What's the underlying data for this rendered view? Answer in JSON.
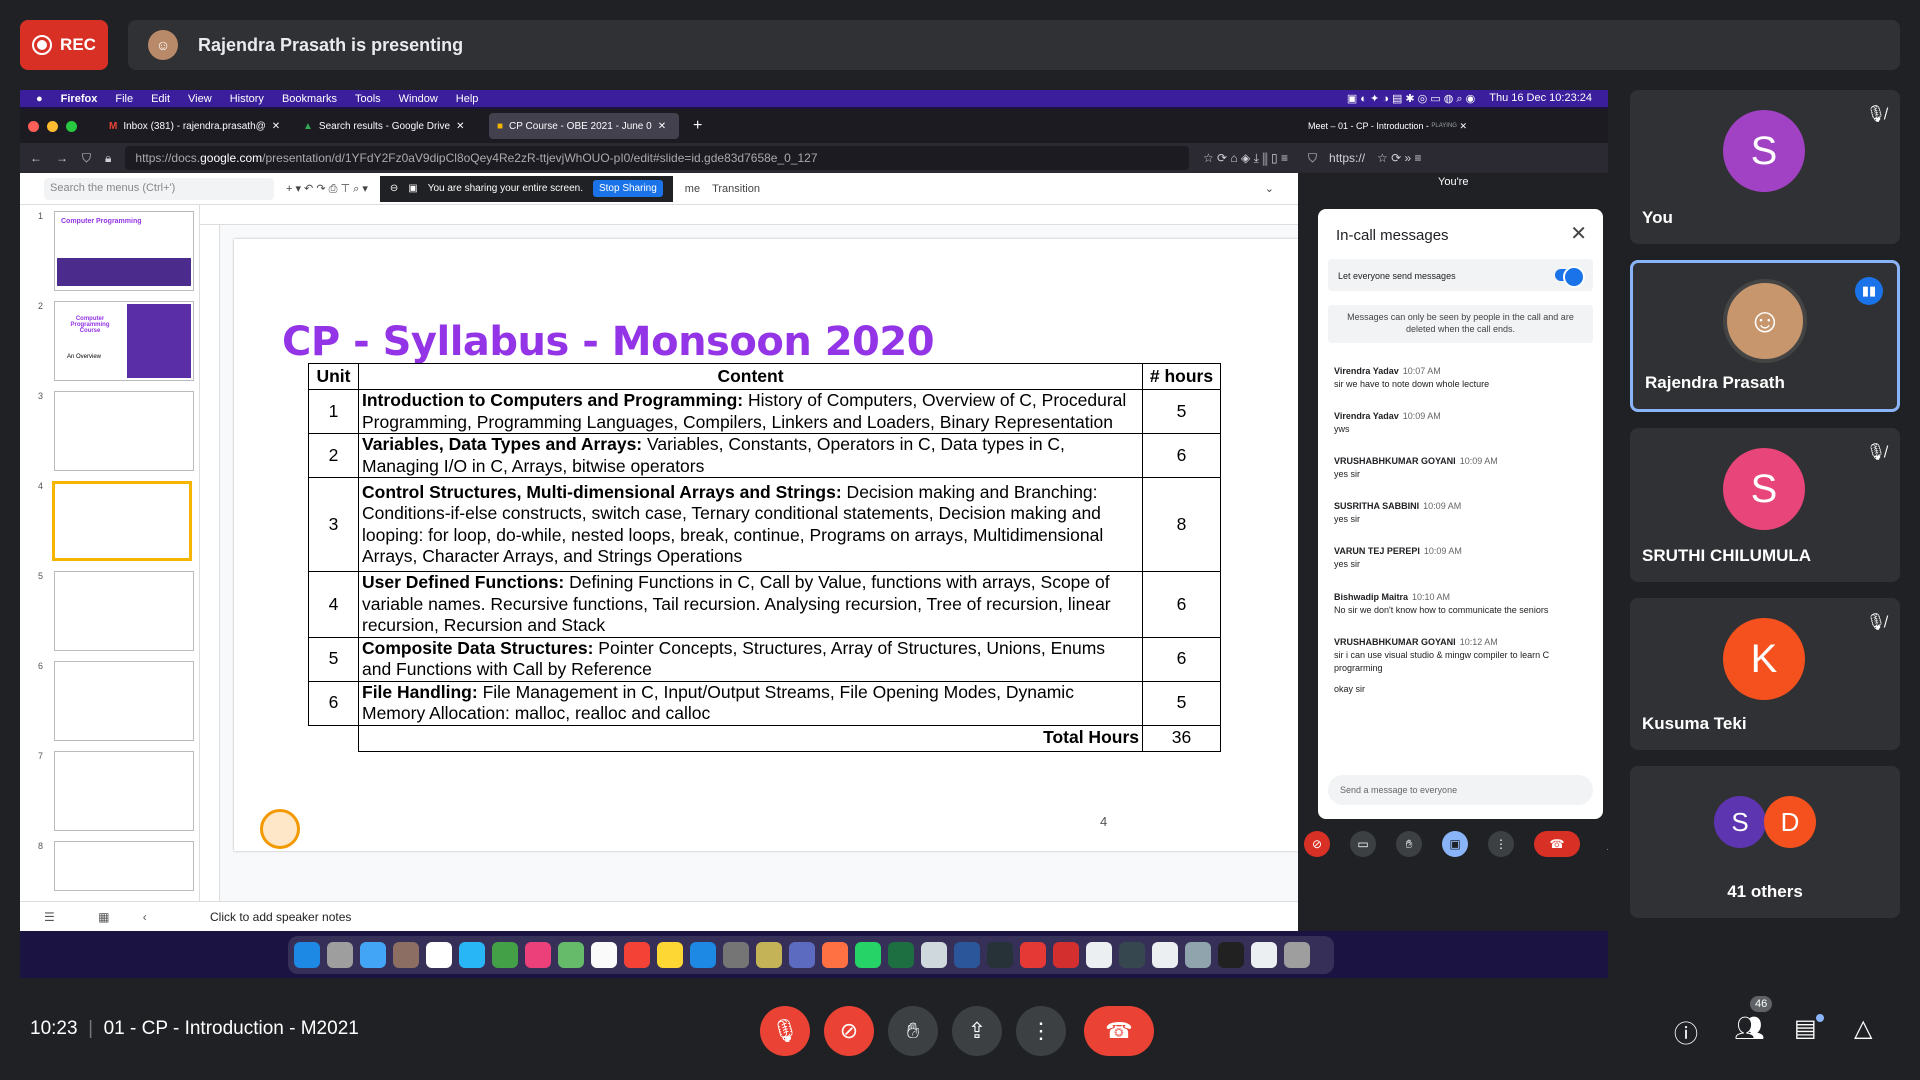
{
  "rec": {
    "label": "REC"
  },
  "presenting": {
    "text": "Rajendra Prasath is presenting"
  },
  "menubar": {
    "app": "Firefox",
    "items": [
      "File",
      "Edit",
      "View",
      "History",
      "Bookmarks",
      "Tools",
      "Window",
      "Help"
    ],
    "datetime": "Thu 16 Dec  10:23:24"
  },
  "browser": {
    "tabs": [
      {
        "label": "Inbox (381) - rajendra.prasath@"
      },
      {
        "label": "Search results - Google Drive"
      },
      {
        "label": "CP Course - OBE 2021 - June 0"
      }
    ],
    "url_prefix": "https://docs.",
    "url_host": "google.com",
    "url_rest": "/presentation/d/1YFdY2Fz0aV9dipCl8oQey4Re2zR-ttjevjWhOUO-pI0/edit#slide=id.gde83d7658e_0_127",
    "search_menus": "Search the menus (Ctrl+')",
    "sharing_msg": "You are sharing your entire screen.",
    "stop_sharing": "Stop Sharing",
    "menu_fragment": "me",
    "transition": "Transition",
    "notes": "Click to add speaker notes"
  },
  "thumbs": {
    "numbers": [
      "1",
      "2",
      "3",
      "4",
      "5",
      "6",
      "7",
      "8"
    ],
    "t1": "Computer Programming",
    "t2": "Computer Programming Course",
    "t2b": "An Overview"
  },
  "slide": {
    "title": "CP - Syllabus - Monsoon 2020",
    "headers": {
      "unit": "Unit",
      "content": "Content",
      "hours": "# hours"
    },
    "rows": [
      {
        "unit": "1",
        "head": "Introduction to Computers and Programming:",
        "body": " History of Computers, Overview of C, Procedural Programming, Programming Languages, Compilers, Linkers and Loaders, Binary Representation",
        "hours": "5"
      },
      {
        "unit": "2",
        "head": "Variables, Data Types and Arrays:",
        "body": " Variables, Constants, Operators in C, Data types in C, Managing I/O in C, Arrays, bitwise operators",
        "hours": "6"
      },
      {
        "unit": "3",
        "head": "Control Structures, Multi-dimensional Arrays and Strings:",
        "body": " Decision making and Branching: Conditions-if-else constructs, switch case, Ternary conditional statements, Decision making and looping: for loop, do-while, nested loops, break, continue, Programs on arrays, Multidimensional Arrays, Character Arrays, and Strings Operations",
        "hours": "8"
      },
      {
        "unit": "4",
        "head": "User Defined Functions:",
        "body": " Defining Functions in C, Call by Value, functions with arrays, Scope of variable names. Recursive functions, Tail recursion. Analysing recursion, Tree of recursion, linear recursion, Recursion and Stack",
        "hours": "6"
      },
      {
        "unit": "5",
        "head": "Composite Data Structures:",
        "body": " Pointer Concepts, Structures, Array of Structures, Unions, Enums and Functions with Call by Reference",
        "hours": "6"
      },
      {
        "unit": "6",
        "head": "File Handling:",
        "body": " File Management in C, Input/Output Streams, File Opening Modes, Dynamic Memory Allocation: malloc, realloc and calloc",
        "hours": "5"
      }
    ],
    "total_label": "Total Hours",
    "total": "36",
    "page": "4"
  },
  "meet_mini": {
    "tab": "Meet – 01 - CP - Introduction -",
    "playing": "PLAYING",
    "url": "https://",
    "youre": "You're"
  },
  "chat": {
    "title": "In-call messages",
    "toggle": "Let everyone send messages",
    "note": "Messages can only be seen by people in the call and are deleted when the call ends.",
    "messages": [
      {
        "name": "Virendra Yadav",
        "time": "10:07 AM",
        "text": "sir we have to note down whole lecture"
      },
      {
        "name": "Virendra Yadav",
        "time": "10:09 AM",
        "text": "yws"
      },
      {
        "name": "VRUSHABHKUMAR GOYANI",
        "time": "10:09 AM",
        "text": "yes sir"
      },
      {
        "name": "SUSRITHA SABBINI",
        "time": "10:09 AM",
        "text": "yes sir"
      },
      {
        "name": "VARUN TEJ PEREPI",
        "time": "10:09 AM",
        "text": "yes sir"
      },
      {
        "name": "Bishwadip Maitra",
        "time": "10:10 AM",
        "text": "No sir we don't know how to communicate the seniors"
      },
      {
        "name": "VRUSHABHKUMAR GOYANI",
        "time": "10:12 AM",
        "text": "sir i can use visual studio & mingw compiler to learn C prograrming"
      }
    ],
    "extra": "okay sir",
    "placeholder": "Send a message to everyone"
  },
  "tiles": [
    {
      "name": "You",
      "initial": "S",
      "color": "#a142c4"
    },
    {
      "name": "Rajendra Prasath"
    },
    {
      "name": "SRUTHI CHILUMULA",
      "initial": "S",
      "color": "#e8457a"
    },
    {
      "name": "Kusuma Teki",
      "initial": "K",
      "color": "#f4511e"
    },
    {
      "name": "41 others",
      "i1": "S",
      "i2": "D"
    }
  ],
  "bottom": {
    "time": "10:23",
    "sep": "|",
    "meeting": "01 - CP - Introduction - M2021",
    "people_count": "46"
  }
}
